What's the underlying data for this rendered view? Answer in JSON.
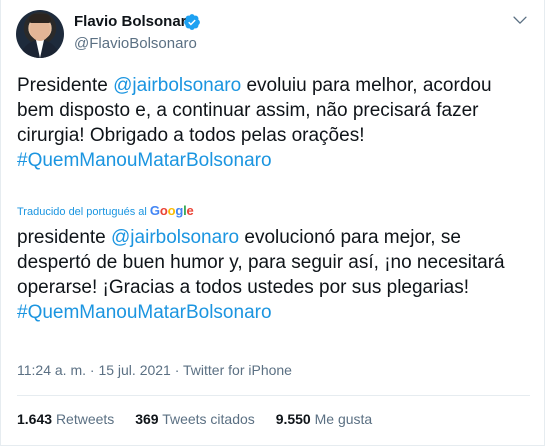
{
  "tweet": {
    "author_name": "Flavio Bolsonaro",
    "author_handle": "@FlavioBolsonaro",
    "original": {
      "before_mention": "Presidente ",
      "mention": "@jairbolsonaro",
      "after_mention": " evoluiu para melhor, acordou bem disposto e, a continuar assim, não precisará fazer cirurgia! Obrigado a todos pelas orações!",
      "hashtag": "#QuemManouMatarBolsonaro"
    },
    "translated_label": "Traducido del portugués al",
    "google_letters": [
      "G",
      "o",
      "o",
      "g",
      "l",
      "e"
    ],
    "translation": {
      "before_mention": "presidente ",
      "mention": "@jairbolsonaro",
      "after_mention": " evolucionó para mejor, se despertó de buen humor y, para seguir así, ¡no necesitará operarse! ¡Gracias a todos ustedes por sus plegarias!",
      "hashtag": "#QuemManouMatarBolsonaro"
    },
    "meta": "11:24 a. m. · 15 jul. 2021 · Twitter for iPhone",
    "stats": {
      "retweets_count": "1.643",
      "retweets_label": "Retweets",
      "quotes_count": "369",
      "quotes_label": "Tweets citados",
      "likes_count": "9.550",
      "likes_label": "Me gusta"
    }
  },
  "colors": {
    "accent": "#1b95e0",
    "secondary_text": "#5b7083",
    "verified": "#1da1f2"
  },
  "icons": {
    "verified": "verified-badge-icon",
    "caret": "chevron-down-icon"
  }
}
